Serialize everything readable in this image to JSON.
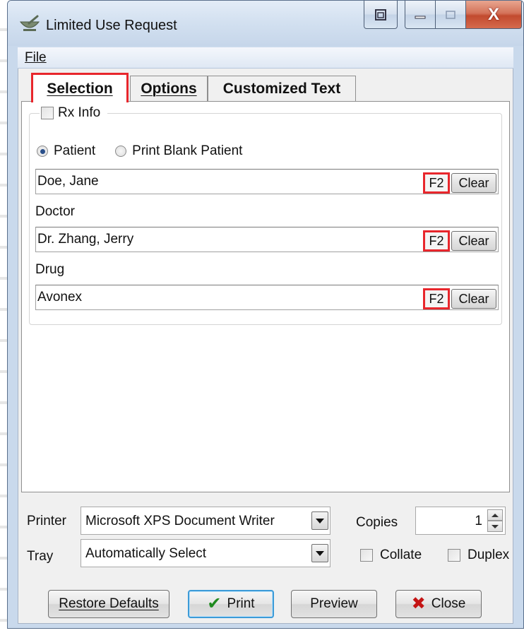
{
  "window": {
    "title": "Limited Use Request",
    "close_glyph": "X"
  },
  "menu": {
    "file": "File"
  },
  "tabs": {
    "selection": "Selection",
    "options": "Options",
    "customized_text": "Customized Text"
  },
  "selection": {
    "rx_info_label": "Rx Info",
    "rx_info_checked": false,
    "patient_radio_label": "Patient",
    "print_blank_radio_label": "Print Blank Patient",
    "patient_selected": true,
    "patient_value": "Doe, Jane",
    "doctor_label": "Doctor",
    "doctor_value": "Dr. Zhang, Jerry",
    "drug_label": "Drug",
    "drug_value": "Avonex",
    "lookup_button": "F2",
    "clear_button": "Clear"
  },
  "printing": {
    "printer_label": "Printer",
    "printer_value": "Microsoft XPS Document Writer",
    "tray_label": "Tray",
    "tray_value": "Automatically Select",
    "copies_label": "Copies",
    "copies_value": "1",
    "collate_label": "Collate",
    "duplex_label": "Duplex"
  },
  "buttons": {
    "restore_defaults": "Restore Defaults",
    "print": "Print",
    "preview": "Preview",
    "close": "Close"
  },
  "colors": {
    "highlight": "#e8262c",
    "print_check": "#1f8a1f",
    "close_x": "#c41414"
  }
}
